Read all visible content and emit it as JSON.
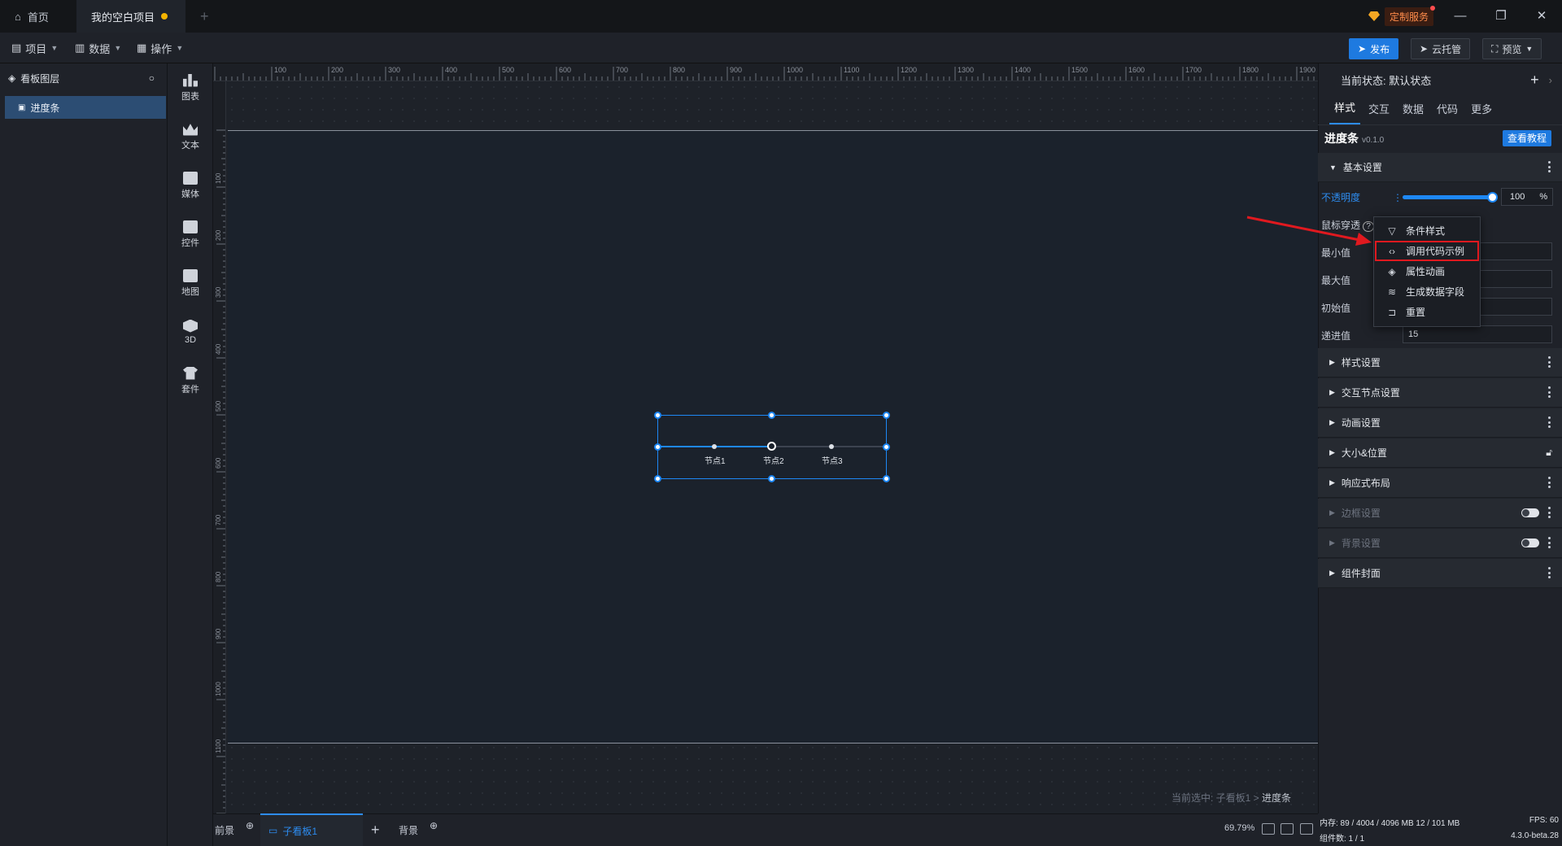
{
  "titlebar": {
    "home_tab": "首页",
    "project_tab": "我的空白项目",
    "custom_service": "定制服务"
  },
  "menus": {
    "project": "项目",
    "data": "数据",
    "operate": "操作"
  },
  "actions": {
    "publish": "发布",
    "cloud": "云托管",
    "preview": "预览"
  },
  "layers": {
    "title": "看板图层",
    "items": [
      "进度条"
    ]
  },
  "iconbar": [
    "图表",
    "文本",
    "媒体",
    "控件",
    "地图",
    "3D",
    "套件"
  ],
  "ruler": {
    "top": [
      "100",
      "200",
      "300",
      "400",
      "500",
      "600",
      "700",
      "800",
      "900",
      "1000",
      "1100",
      "1200",
      "1300",
      "1400",
      "1500",
      "1600",
      "1700",
      "1800",
      "1900"
    ],
    "left": [
      "100",
      "200",
      "300",
      "400",
      "500",
      "600",
      "700",
      "800",
      "900",
      "1000",
      "1100"
    ]
  },
  "progress": {
    "nodes": [
      "节点1",
      "节点2",
      "节点3"
    ],
    "fill": 0.5
  },
  "breadcrumb": {
    "prefix": "当前选中: 子看板1 >",
    "current": "进度条"
  },
  "bottom": {
    "foreground": "前景",
    "subboard": "子看板1",
    "background": "背景",
    "zoom": "69.79%"
  },
  "right": {
    "state_label": "当前状态: 默认状态",
    "tabs": [
      "样式",
      "交互",
      "数据",
      "代码",
      "更多"
    ],
    "component": "进度条",
    "version": "v0.1.0",
    "tutorial": "查看教程",
    "basic": "基本设置",
    "props": {
      "opacity": "不透明度",
      "opacity_value": "100",
      "opacity_unit": "%",
      "mouse": "鼠标穿透",
      "min": "最小值",
      "max": "最大值",
      "init": "初始值",
      "step": "递进值",
      "step_value": "15"
    },
    "sections": [
      "样式设置",
      "交互节点设置",
      "动画设置",
      "大小&位置",
      "响应式布局",
      "边框设置",
      "背景设置",
      "组件封面"
    ]
  },
  "context_menu": [
    "条件样式",
    "调用代码示例",
    "属性动画",
    "生成数据字段",
    "重置"
  ],
  "status": {
    "memory": "内存: 89 / 4004 / 4096 MB  12 / 101 MB",
    "fps": "FPS: 60",
    "components": "组件数: 1 / 1",
    "version": "4.3.0-beta.28"
  },
  "colors": {
    "accent": "#1e7ae0",
    "highlight": "#e0191f",
    "arrow": "#e0191f"
  }
}
